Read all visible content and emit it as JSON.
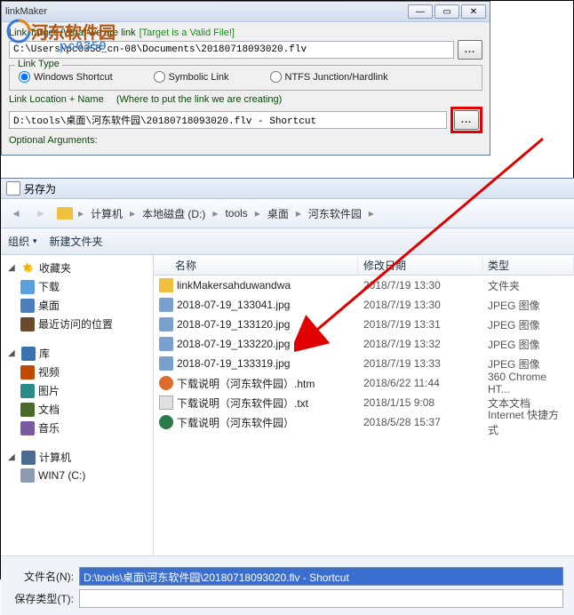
{
  "linkmaker": {
    "title": "linkMaker",
    "labels": {
      "target": "Link Target",
      "target_hint": "(What we are link",
      "target_valid": "[Target is a Valid File!]",
      "link_type": "Link Type",
      "location": "Link Location + Name",
      "location_hint": "(Where to put the link we are creating)",
      "optional_args": "Optional Arguments:"
    },
    "target_path": "C:\\Users\\pc0358_cn-08\\Documents\\20180718093020.flv",
    "location_path": "D:\\tools\\桌面\\河东软件园\\20180718093020.flv - Shortcut",
    "radios": {
      "shortcut": "Windows Shortcut",
      "symbolic": "Symbolic Link",
      "ntfs": "NTFS Junction/Hardlink"
    },
    "browse": "..."
  },
  "watermark": {
    "brand": "河东软件园",
    "sub": "pc0359"
  },
  "saveas": {
    "title": "另存为",
    "crumbs": [
      "计算机",
      "本地磁盘 (D:)",
      "tools",
      "桌面",
      "河东软件园"
    ],
    "toolbar": {
      "organize": "组织",
      "newfolder": "新建文件夹"
    },
    "sidebar": {
      "fav": "收藏夹",
      "fav_items": [
        "下载",
        "桌面",
        "最近访问的位置"
      ],
      "lib": "库",
      "lib_items": [
        "视频",
        "图片",
        "文档",
        "音乐"
      ],
      "comp": "计算机",
      "comp_items": [
        "WIN7 (C:)"
      ]
    },
    "cols": {
      "name": "名称",
      "date": "修改日期",
      "type": "类型"
    },
    "files": [
      {
        "name": "linkMakersahduwandwa",
        "date": "2018/7/19 13:30",
        "type": "文件夹",
        "icon": "folder"
      },
      {
        "name": "2018-07-19_133041.jpg",
        "date": "2018/7/19 13:30",
        "type": "JPEG 图像",
        "icon": "jpg"
      },
      {
        "name": "2018-07-19_133120.jpg",
        "date": "2018/7/19 13:31",
        "type": "JPEG 图像",
        "icon": "jpg"
      },
      {
        "name": "2018-07-19_133220.jpg",
        "date": "2018/7/19 13:32",
        "type": "JPEG 图像",
        "icon": "jpg"
      },
      {
        "name": "2018-07-19_133319.jpg",
        "date": "2018/7/19 13:33",
        "type": "JPEG 图像",
        "icon": "jpg"
      },
      {
        "name": "下载说明（河东软件园）.htm",
        "date": "2018/6/22 11:44",
        "type": "360 Chrome HT...",
        "icon": "htm"
      },
      {
        "name": "下载说明（河东软件园）.txt",
        "date": "2018/1/15 9:08",
        "type": "文本文档",
        "icon": "txt"
      },
      {
        "name": "下载说明（河东软件园）",
        "date": "2018/5/28 15:37",
        "type": "Internet 快捷方式",
        "icon": "url"
      }
    ],
    "bottom": {
      "filename_label": "文件名(N):",
      "filename_value": "D:\\tools\\桌面\\河东软件园\\20180718093020.flv - Shortcut",
      "filetype_label": "保存类型(T):"
    }
  }
}
